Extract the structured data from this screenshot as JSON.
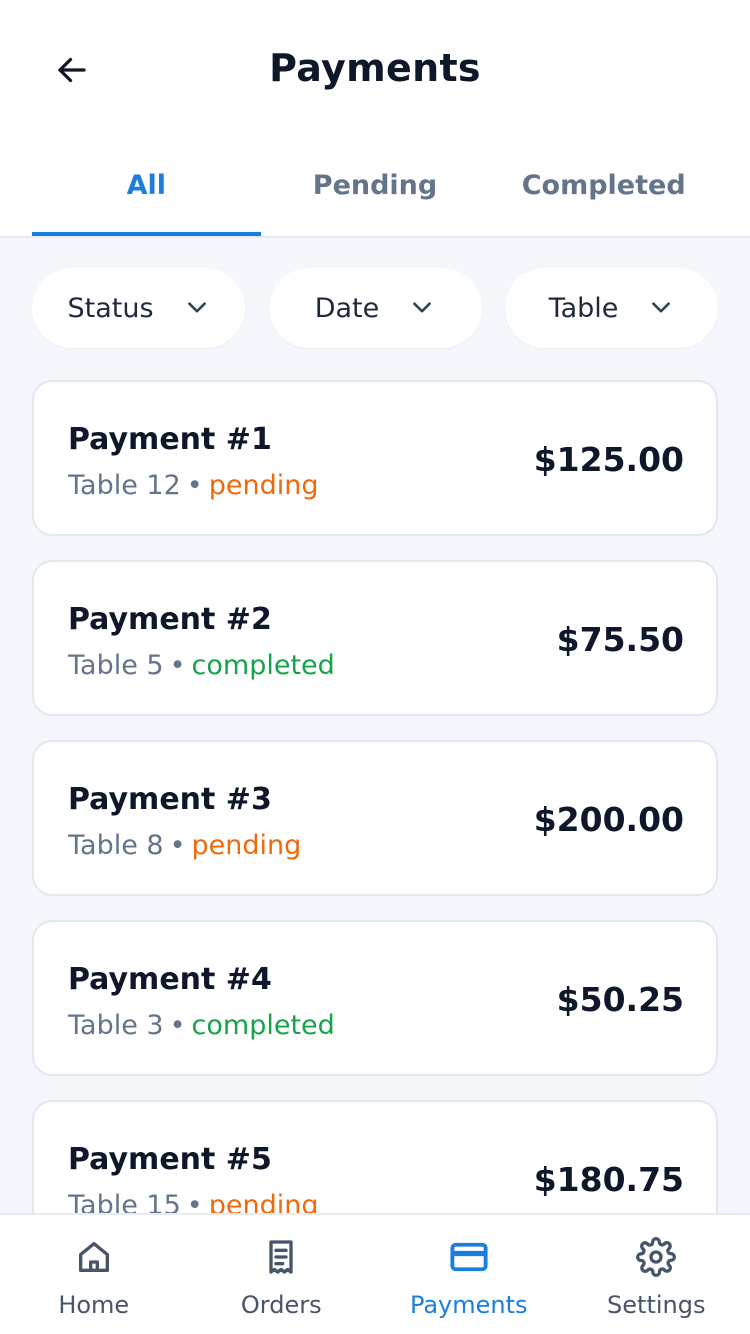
{
  "header": {
    "title": "Payments",
    "back_icon": "arrow-left-icon"
  },
  "tabs": [
    {
      "label": "All",
      "active": true
    },
    {
      "label": "Pending",
      "active": false
    },
    {
      "label": "Completed",
      "active": false
    }
  ],
  "filters": [
    {
      "label": "Status",
      "icon": "chevron-down-icon"
    },
    {
      "label": "Date",
      "icon": "chevron-down-icon"
    },
    {
      "label": "Table",
      "icon": "chevron-down-icon"
    }
  ],
  "payments": [
    {
      "title": "Payment #1",
      "table": "Table 12",
      "separator": "•",
      "status": "pending",
      "amount": "$125.00"
    },
    {
      "title": "Payment #2",
      "table": "Table 5",
      "separator": "•",
      "status": "completed",
      "amount": "$75.50"
    },
    {
      "title": "Payment #3",
      "table": "Table 8",
      "separator": "•",
      "status": "pending",
      "amount": "$200.00"
    },
    {
      "title": "Payment #4",
      "table": "Table 3",
      "separator": "•",
      "status": "completed",
      "amount": "$50.25"
    },
    {
      "title": "Payment #5",
      "table": "Table 15",
      "separator": "•",
      "status": "pending",
      "amount": "$180.75"
    }
  ],
  "bottom_nav": [
    {
      "label": "Home",
      "icon": "home-icon",
      "active": false
    },
    {
      "label": "Orders",
      "icon": "receipt-icon",
      "active": false
    },
    {
      "label": "Payments",
      "icon": "credit-card-icon",
      "active": true
    },
    {
      "label": "Settings",
      "icon": "gear-icon",
      "active": false
    }
  ],
  "colors": {
    "accent": "#1a7ee0",
    "pending": "#f06a0c",
    "completed": "#16a34a",
    "background": "#f4f7fb"
  }
}
